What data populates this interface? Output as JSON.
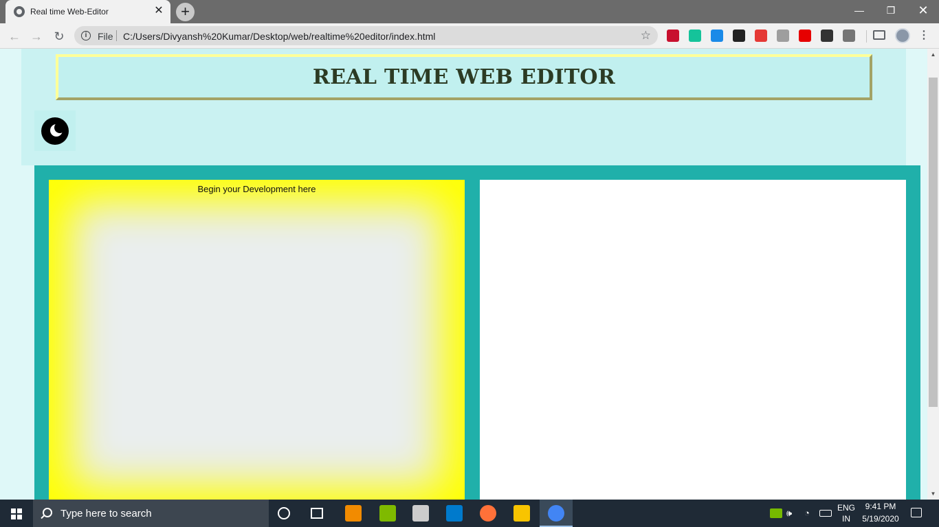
{
  "browser": {
    "tab": {
      "title": "Real time Web-Editor",
      "close_glyph": "✕",
      "favicon": "globe-icon"
    },
    "new_tab_glyph": "+",
    "window_controls": {
      "minimize": "—",
      "restore": "❐",
      "close": "✕"
    },
    "toolbar": {
      "back_glyph": "←",
      "forward_glyph": "→",
      "reload_glyph": "↻",
      "info_glyph": "i",
      "security_label": "File",
      "url": "C:/Users/Divyansh%20Kumar/Desktop/web/realtime%20editor/index.html",
      "star_glyph": "☆",
      "menu_glyph": "⋮",
      "extensions": [
        {
          "name": "mcafee-extension-icon",
          "color": "#c8102e"
        },
        {
          "name": "grammarly-extension-icon",
          "color": "#15c39a"
        },
        {
          "name": "download-extension-icon",
          "color": "#1a8ae8"
        },
        {
          "name": "document-extension-icon",
          "color": "#222222"
        },
        {
          "name": "speedtest-extension-icon",
          "color": "#e53935"
        },
        {
          "name": "mouse-extension-icon",
          "color": "#9e9e9e"
        },
        {
          "name": "adblock-extension-icon",
          "color": "#e60000"
        },
        {
          "name": "cube-extension-icon",
          "color": "#333333"
        },
        {
          "name": "image-extension-icon",
          "color": "#757575"
        }
      ]
    }
  },
  "page": {
    "title": "REAL TIME WEB EDITOR",
    "theme_toggle_icon": "moon-icon",
    "code_editor": {
      "placeholder": "Begin your Development here"
    },
    "colors": {
      "page_background": "#dff8f8",
      "header_background": "#c1f0ef",
      "editor_frame": "#20b0aa",
      "editor_glow": "#ffff00",
      "title_text": "#2c3b24"
    }
  },
  "scrollbar": {
    "up_glyph": "▲",
    "down_glyph": "▼"
  },
  "taskbar": {
    "search_placeholder": "Type here to search",
    "apps": [
      {
        "name": "cortana-icon"
      },
      {
        "name": "task-view-icon"
      },
      {
        "name": "sublime-text-icon"
      },
      {
        "name": "microsoft-store-icon"
      },
      {
        "name": "network-app-icon"
      },
      {
        "name": "vscode-icon"
      },
      {
        "name": "firefox-icon"
      },
      {
        "name": "file-explorer-icon"
      },
      {
        "name": "chrome-icon",
        "active": true
      }
    ],
    "tray": {
      "language_top": "ENG",
      "language_bottom": "IN",
      "time": "9:41 PM",
      "date": "5/19/2020",
      "volume_glyph": "🕪",
      "wifi_glyph": "◔"
    }
  }
}
